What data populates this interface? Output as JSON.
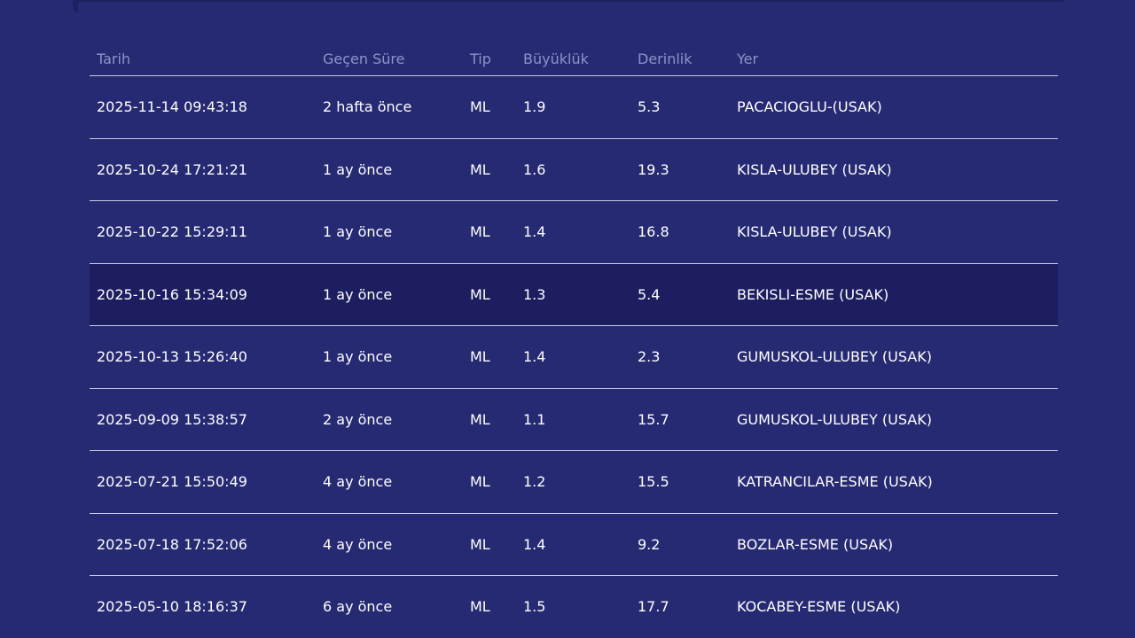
{
  "table": {
    "headers": [
      "Tarih",
      "Geçen Süre",
      "Tip",
      "Büyüklük",
      "Derinlik",
      "Yer"
    ],
    "rows": [
      {
        "date": "2025-11-14 09:43:18",
        "elapsed": "2 hafta önce",
        "type": "ML",
        "magnitude": "1.9",
        "depth": "5.3",
        "location": "PACACIOGLU-(USAK)"
      },
      {
        "date": "2025-10-24 17:21:21",
        "elapsed": "1 ay önce",
        "type": "ML",
        "magnitude": "1.6",
        "depth": "19.3",
        "location": "KISLA-ULUBEY (USAK)"
      },
      {
        "date": "2025-10-22 15:29:11",
        "elapsed": "1 ay önce",
        "type": "ML",
        "magnitude": "1.4",
        "depth": "16.8",
        "location": "KISLA-ULUBEY (USAK)"
      },
      {
        "date": "2025-10-16 15:34:09",
        "elapsed": "1 ay önce",
        "type": "ML",
        "magnitude": "1.3",
        "depth": "5.4",
        "location": "BEKISLI-ESME (USAK)"
      },
      {
        "date": "2025-10-13 15:26:40",
        "elapsed": "1 ay önce",
        "type": "ML",
        "magnitude": "1.4",
        "depth": "2.3",
        "location": "GUMUSKOL-ULUBEY (USAK)"
      },
      {
        "date": "2025-09-09 15:38:57",
        "elapsed": "2 ay önce",
        "type": "ML",
        "magnitude": "1.1",
        "depth": "15.7",
        "location": "GUMUSKOL-ULUBEY (USAK)"
      },
      {
        "date": "2025-07-21 15:50:49",
        "elapsed": "4 ay önce",
        "type": "ML",
        "magnitude": "1.2",
        "depth": "15.5",
        "location": "KATRANCILAR-ESME (USAK)"
      },
      {
        "date": "2025-07-18 17:52:06",
        "elapsed": "4 ay önce",
        "type": "ML",
        "magnitude": "1.4",
        "depth": "9.2",
        "location": "BOZLAR-ESME (USAK)"
      },
      {
        "date": "2025-05-10 18:16:37",
        "elapsed": "6 ay önce",
        "type": "ML",
        "magnitude": "1.5",
        "depth": "17.7",
        "location": "KOCABEY-ESME (USAK)"
      }
    ]
  },
  "colors": {
    "background": "#262a72",
    "highlight_row": "#1c1e60",
    "header_text": "#8d93c9",
    "cell_text": "#ffffff",
    "divider": "#c8cbe6"
  }
}
